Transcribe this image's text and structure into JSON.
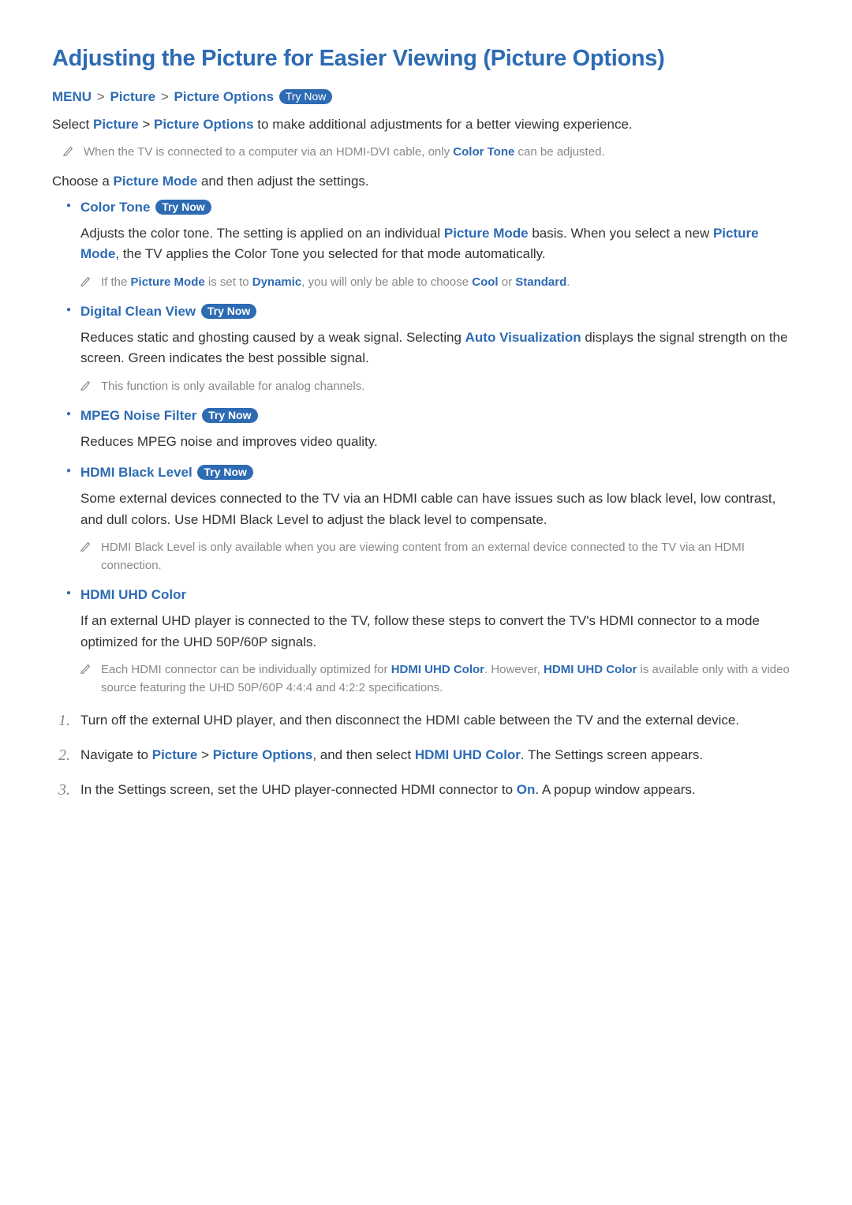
{
  "title": "Adjusting the Picture for Easier Viewing (Picture Options)",
  "breadcrumb": {
    "menu": "MENU",
    "picture": "Picture",
    "options": "Picture Options",
    "try_now": "Try Now",
    "sep": ">"
  },
  "intro": {
    "prefix": "Select ",
    "picture": "Picture",
    "sep": " > ",
    "options": "Picture Options",
    "suffix": " to make additional adjustments for a better viewing experience."
  },
  "intro_note": {
    "before": "When the TV is connected to a computer via an HDMI-DVI cable, only ",
    "hl": "Color Tone",
    "after": " can be adjusted."
  },
  "choose": {
    "before": "Choose a ",
    "hl": "Picture Mode",
    "after": " and then adjust the settings."
  },
  "color_tone": {
    "title": "Color Tone",
    "try_now": "Try Now",
    "body": {
      "t1": "Adjusts the color tone. The setting is applied on an individual ",
      "h1": "Picture Mode",
      "t2": " basis. When you select a new ",
      "h2": "Picture Mode",
      "t3": ", the TV applies the Color Tone you selected for that mode automatically."
    },
    "note": {
      "t1": "If the ",
      "h1": "Picture Mode",
      "t2": " is set to ",
      "h2": "Dynamic",
      "t3": ", you will only be able to choose ",
      "h3": "Cool",
      "t4": " or ",
      "h4": "Standard",
      "t5": "."
    }
  },
  "dcv": {
    "title": "Digital Clean View",
    "try_now": "Try Now",
    "body": {
      "t1": "Reduces static and ghosting caused by a weak signal. Selecting ",
      "h1": "Auto Visualization",
      "t2": " displays the signal strength on the screen. Green indicates the best possible signal."
    },
    "note": "This function is only available for analog channels."
  },
  "mpeg": {
    "title": "MPEG Noise Filter",
    "try_now": "Try Now",
    "body": "Reduces MPEG noise and improves video quality."
  },
  "hdmi_black": {
    "title": "HDMI Black Level",
    "try_now": "Try Now",
    "body": "Some external devices connected to the TV via an HDMI cable can have issues such as low black level, low contrast, and dull colors. Use HDMI Black Level to adjust the black level to compensate.",
    "note": "HDMI Black Level is only available when you are viewing content from an external device connected to the TV via an HDMI connection."
  },
  "hdmi_uhd": {
    "title": "HDMI UHD Color",
    "body": "If an external UHD player is connected to the TV, follow these steps to convert the TV's HDMI connector to a mode optimized for the UHD 50P/60P signals.",
    "note": {
      "t1": "Each HDMI connector can be individually optimized for ",
      "h1": "HDMI UHD Color",
      "t2": ". However, ",
      "h2": "HDMI UHD Color",
      "t3": " is available only with a video source featuring the UHD 50P/60P 4:4:4 and 4:2:2 specifications."
    }
  },
  "steps": {
    "s1": "Turn off the external UHD player, and then disconnect the HDMI cable between the TV and the external device.",
    "s2": {
      "t1": "Navigate to ",
      "h1": "Picture",
      "t2": " > ",
      "h2": "Picture Options",
      "t3": ", and then select ",
      "h3": "HDMI UHD Color",
      "t4": ". The Settings screen appears."
    },
    "s3": {
      "t1": "In the Settings screen, set the UHD player-connected HDMI connector to ",
      "h1": "On",
      "t2": ". A popup window appears."
    }
  }
}
